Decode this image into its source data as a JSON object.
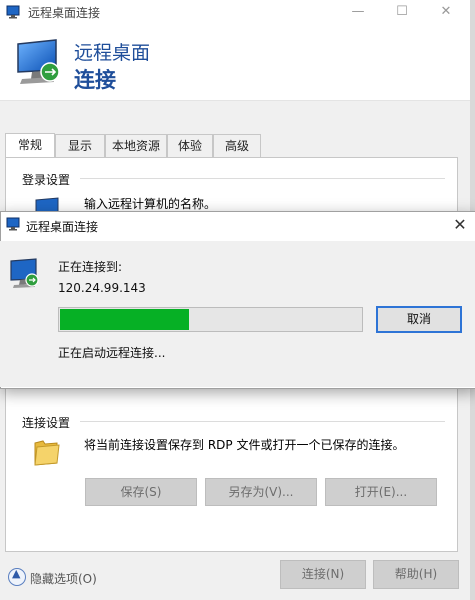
{
  "background_window": {
    "title": "远程桌面连接",
    "window_controls": {
      "minimize": "—",
      "maximize": "☐",
      "close": "✕"
    },
    "header": {
      "line1": "远程桌面",
      "line2": "连接"
    },
    "tabs": [
      {
        "label": "常规",
        "active": true
      },
      {
        "label": "显示",
        "active": false
      },
      {
        "label": "本地资源",
        "active": false
      },
      {
        "label": "体验",
        "active": false
      },
      {
        "label": "高级",
        "active": false
      }
    ],
    "login_settings": {
      "group_label": "登录设置",
      "prompt": "输入远程计算机的名称。"
    },
    "connection_settings": {
      "group_label": "连接设置",
      "description": "将当前连接设置保存到 RDP 文件或打开一个已保存的连接。",
      "save_button": "保存(S)",
      "save_as_button": "另存为(V)...",
      "open_button": "打开(E)..."
    },
    "footer": {
      "hide_options": "隐藏选项(O)",
      "hide_options_icon": "▲",
      "connect_button": "连接(N)",
      "help_button": "帮助(H)"
    }
  },
  "dialog": {
    "title": "远程桌面连接",
    "close_glyph": "✕",
    "connecting_label": "正在连接到:",
    "address": "120.24.99.143",
    "progress_percent": 43,
    "cancel_button": "取消",
    "status": "正在启动远程连接..."
  },
  "colors": {
    "header_text": "#1f4e9a",
    "progress_fill": "#06b025",
    "focus_border": "#2e74d6"
  }
}
